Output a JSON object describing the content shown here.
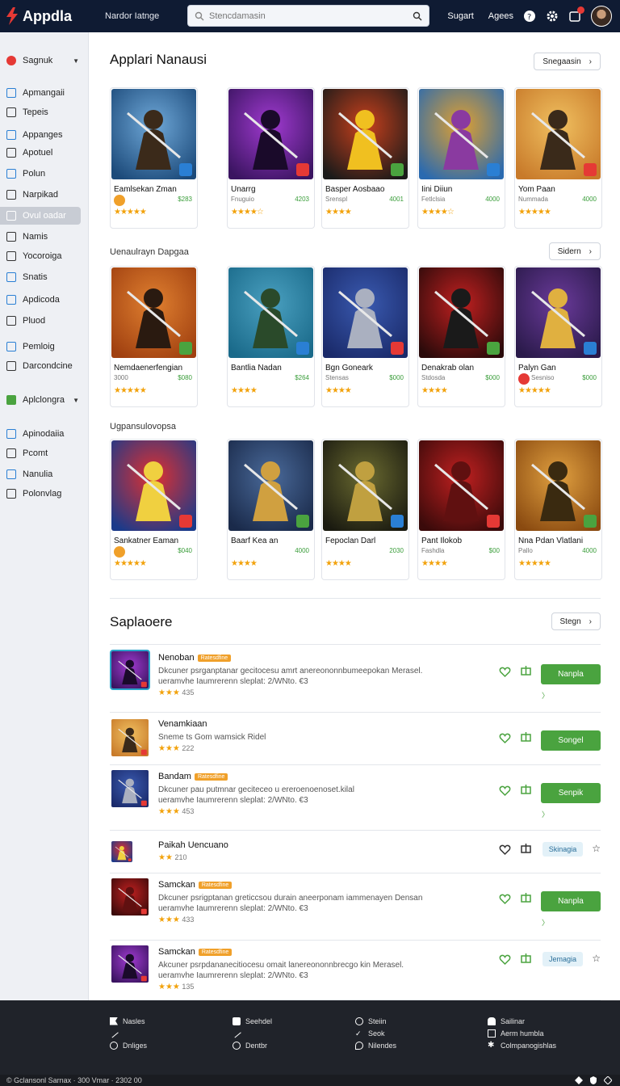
{
  "header": {
    "app_name": "Appdla",
    "nav_link": "Nardor Iatnge",
    "search_placeholder": "Stencdamasin",
    "links": [
      "Sugart",
      "Agees"
    ]
  },
  "sidebar": {
    "items": [
      {
        "label": "Sagnuk",
        "icon": "red-circle-icon",
        "caret": true
      },
      {
        "label": "Apmangaii",
        "icon": "gear-icon"
      },
      {
        "label": "Tepeis",
        "icon": "tag-icon"
      },
      {
        "label": "Appanges",
        "icon": "box-icon"
      },
      {
        "label": "Apotuel",
        "icon": "square-icon"
      },
      {
        "label": "Polun",
        "icon": "screen-icon"
      },
      {
        "label": "Narpikad",
        "icon": "link-icon"
      },
      {
        "label": "Ovul oadar",
        "icon": "search-icon",
        "active": true
      },
      {
        "label": "Namis",
        "icon": "grid-icon"
      },
      {
        "label": "Yocoroiga",
        "icon": "edit-icon"
      },
      {
        "label": "Snatis",
        "icon": "chart-icon"
      },
      {
        "label": "Apdicoda",
        "icon": "doc-icon"
      },
      {
        "label": "Pluod",
        "icon": "cloud-icon"
      },
      {
        "label": "Pemloig",
        "icon": "globe-icon"
      },
      {
        "label": "Darcondcine",
        "icon": "sparkle-icon"
      },
      {
        "label": "Aplclongra",
        "icon": "green-box-icon",
        "caret": true
      },
      {
        "label": "Apinodaiia",
        "icon": "gear-icon"
      },
      {
        "label": "Pcomt",
        "icon": "list-icon"
      },
      {
        "label": "Nanulia",
        "icon": "screen-icon"
      },
      {
        "label": "Polonvlag",
        "icon": "puzzle-icon"
      }
    ]
  },
  "sections": {
    "featured": {
      "title": "Applari Nanausi",
      "button": "Snegaasin"
    },
    "second": {
      "title": "Uenaulrayn Dapgaa",
      "button": "Sidern"
    },
    "third": {
      "title": "Ugpansulovopsa"
    },
    "list": {
      "title": "Saplaoere",
      "button": "Stegn"
    }
  },
  "cards": [
    [
      {
        "name": "Eamlsekan Zman",
        "dev": "",
        "price": "$283",
        "stars": "★★★★★",
        "badge": "#f0a02a"
      },
      {
        "name": "Unarrg",
        "dev": "Fnuguio",
        "price": "4203",
        "stars": "★★★★☆"
      },
      {
        "name": "Basper Aosbaao",
        "dev": "Srenspl",
        "price": "4001",
        "stars": "★★★★"
      },
      {
        "name": "Iini Diiun",
        "dev": "Fetlclsia",
        "price": "4000",
        "stars": "★★★★☆"
      },
      {
        "name": "Yom Paan",
        "dev": "Nummada",
        "price": "4000",
        "stars": "★★★★★"
      }
    ],
    [
      {
        "name": "Nemdaenerfengian",
        "dev": "3000",
        "price": "$080",
        "stars": "★★★★★"
      },
      {
        "name": "Bantlia Nadan",
        "dev": "",
        "price": "$264",
        "stars": "★★★★"
      },
      {
        "name": "Bgn Goneark",
        "dev": "Stensas",
        "price": "$000",
        "stars": "★★★★"
      },
      {
        "name": "Denakrab olan",
        "dev": "Stdosda",
        "price": "$000",
        "stars": "★★★★"
      },
      {
        "name": "Palyn Gan",
        "dev": "Sesniso",
        "price": "$000",
        "stars": "★★★★★",
        "badge": "#e53935"
      }
    ],
    [
      {
        "name": "Sankatner Eaman",
        "dev": "",
        "price": "$040",
        "stars": "★★★★★",
        "badge": "#f0a02a"
      },
      {
        "name": "Baarf Kea an",
        "dev": "",
        "price": "4000",
        "stars": "★★★★"
      },
      {
        "name": "Fepoclan Darl",
        "dev": "",
        "price": "2030",
        "stars": "★★★★"
      },
      {
        "name": "Pant Ilokob",
        "dev": "Fashdla",
        "price": "$00",
        "stars": "★★★★"
      },
      {
        "name": "Nna Pdan Vlatlani",
        "dev": "Pallo",
        "price": "4000",
        "stars": "★★★★★"
      }
    ]
  ],
  "list_rows": [
    {
      "name": "Nenoban",
      "tag": "Ratesdfine",
      "desc1": "Dkcuner psrganptanar gecitocesu amrt anereononnbumeepokan Merasel.",
      "desc2": "ueramvhe Iaumrerenn sleplat: 2/WNto. €3",
      "stars": "★★★",
      "rating": "435",
      "button": "Nanpla",
      "chev": "〉"
    },
    {
      "name": "Venamkiaan",
      "tag": "",
      "desc1": "Sneme ts Gom wamsick Ridel",
      "desc2": "",
      "stars": "★★★",
      "rating": "222",
      "button": "Songel",
      "chev": ""
    },
    {
      "name": "Bandam",
      "tag": "Ratesdfine",
      "desc1": "Dkcuner pau putmnar geciteceo u ereroenoenoset.kilal",
      "desc2": "ueramvhe Iaumrerenn sleplat: 2/WNto. €3",
      "stars": "★★★",
      "rating": "453",
      "button": "Senpik",
      "chev": "〉"
    },
    {
      "name": "Paikah Uencuano",
      "tag": "",
      "desc1": "",
      "desc2": "",
      "stars": "★★",
      "rating": "210",
      "button": "Skinagia",
      "chev": ""
    },
    {
      "name": "Samckan",
      "tag": "Ratesdfine",
      "desc1": "Dkcuner psrigptanan greticcsou durain aneerponam iammenayen Densan",
      "desc2": "ueramvhe Iaumrerenn sleplat: 2/WNto. €3",
      "stars": "★★★",
      "rating": "433",
      "button": "Nanpla",
      "chev": "〉"
    },
    {
      "name": "Samckan",
      "tag": "Ratesdfine",
      "desc1": "Akcuner psrpdananecitiocesu omait lanereononnbrecgo kin Merasel.",
      "desc2": "ueramvhe Iaumrerenn sleplat: 2/WNto. €3",
      "stars": "★★★",
      "rating": "135",
      "button": "Jemagia",
      "chev": ""
    }
  ],
  "footer": {
    "col1": [
      "Nasles",
      "",
      "Dnliges"
    ],
    "col2": [
      "Seehdel",
      "",
      "Dentbr"
    ],
    "col3": [
      "Steiin",
      "Seok",
      "Nilendes"
    ],
    "col4": [
      "Sailinar",
      "Aerm humbla",
      "Colmpanogishlas"
    ]
  },
  "copyright": "© Gclansonl Sarnax · 300 Vmar · 2302 00",
  "colors": {
    "header_bg": "#0f1b33",
    "accent_green": "#4aa33f",
    "star": "#f2a20c",
    "footer_bg": "#20232a"
  }
}
